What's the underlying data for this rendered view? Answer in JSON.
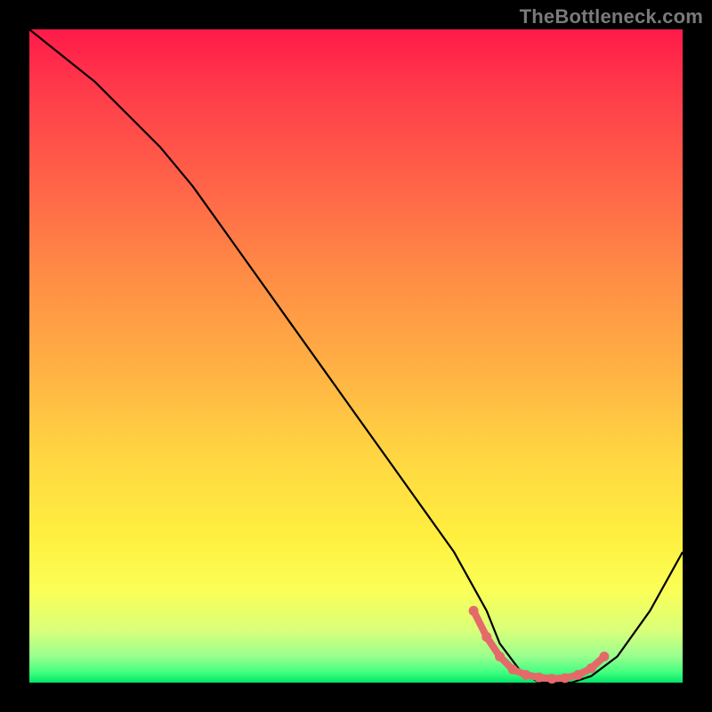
{
  "watermark": "TheBottleneck.com",
  "chart_data": {
    "type": "line",
    "title": "",
    "xlabel": "",
    "ylabel": "",
    "xlim": [
      0,
      100
    ],
    "ylim": [
      0,
      100
    ],
    "background_gradient_meaning": "bottleneck severity (red=high, green=low)",
    "series": [
      {
        "name": "bottleneck-curve",
        "x": [
          0,
          5,
          10,
          15,
          20,
          25,
          30,
          35,
          40,
          45,
          50,
          55,
          60,
          65,
          70,
          72,
          75,
          78,
          80,
          83,
          86,
          90,
          95,
          100
        ],
        "values": [
          100,
          96,
          92,
          87,
          82,
          76,
          69,
          62,
          55,
          48,
          41,
          34,
          27,
          20,
          11,
          6,
          2,
          0,
          0,
          0,
          1,
          4,
          11,
          20
        ]
      }
    ],
    "highlight": {
      "name": "optimal-range-marker",
      "color": "#e46a6a",
      "x": [
        68,
        70,
        72,
        74,
        76,
        78,
        80,
        82,
        84,
        86,
        88
      ],
      "values": [
        11,
        7,
        4,
        2,
        1.2,
        0.8,
        0.6,
        0.7,
        1.2,
        2.2,
        4
      ]
    }
  }
}
